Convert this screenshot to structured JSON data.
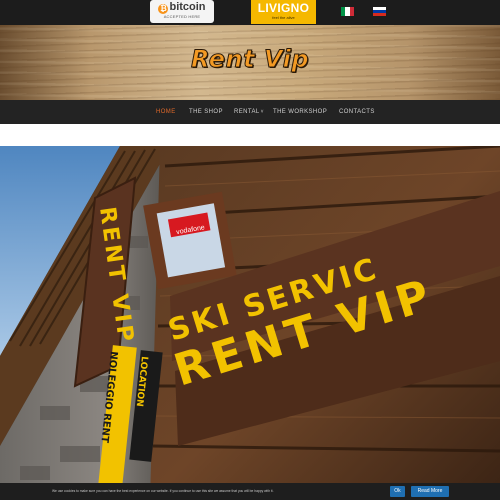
{
  "topbar": {
    "bitcoin_badge": {
      "name": "bitcoin",
      "tagline": "ACCEPTED HERE"
    },
    "livigno_badge": {
      "name": "LIVIGNO",
      "tagline": "feel the alive"
    },
    "flags": [
      {
        "icon": "flag-italy-icon",
        "colors": [
          "#009246",
          "#ffffff",
          "#ce2b37"
        ]
      },
      {
        "icon": "flag-russia-icon",
        "colors": [
          "#ffffff",
          "#0039a6",
          "#d52b1e"
        ]
      }
    ]
  },
  "banner": {
    "title": "Rent Vip"
  },
  "nav": {
    "items": [
      {
        "label": "HOME",
        "active": true
      },
      {
        "label": "THE SHOP"
      },
      {
        "label": "RENTAL",
        "has_dropdown": true
      },
      {
        "label": "THE WORKSHOP"
      },
      {
        "label": "CONTACTS"
      }
    ],
    "active_color": "#e2692a"
  },
  "hero": {
    "signs": {
      "vertical_sign": "RENT VIP",
      "main_line_1": "SKI SERVIC",
      "main_line_2": "RENT VIP",
      "small_sign_left": "NOLEGGIO RENT",
      "small_sign_right": "LOCATION",
      "window_sticker": "vodafone"
    }
  },
  "cookie_bar": {
    "text": "We use cookies to make sure you can have the best experience on our website. If you continue to use this site we assume that you will be happy with it.",
    "ok_label": "Ok",
    "more_label": "Read More"
  },
  "colors": {
    "accent": "#e2692a",
    "sign_yellow": "#f2c200",
    "button_blue": "#1f6fb2"
  }
}
